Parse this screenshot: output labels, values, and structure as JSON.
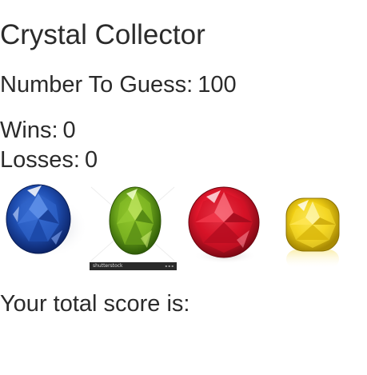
{
  "app": {
    "title": "Crystal Collector"
  },
  "game": {
    "target_label": "Number To Guess:",
    "target_value": "100",
    "wins_label": "Wins:",
    "wins_value": "0",
    "losses_label": "Losses:",
    "losses_value": "0",
    "score_label": "Your total score is:",
    "score_value": ""
  },
  "crystals": [
    {
      "name": "blue sapphire",
      "color": "#1f4fb3"
    },
    {
      "name": "green peridot",
      "color": "#6aa21a",
      "watermark": "shutterstock"
    },
    {
      "name": "red ruby",
      "color": "#e0162b"
    },
    {
      "name": "yellow citrine",
      "color": "#f1cf14"
    }
  ]
}
